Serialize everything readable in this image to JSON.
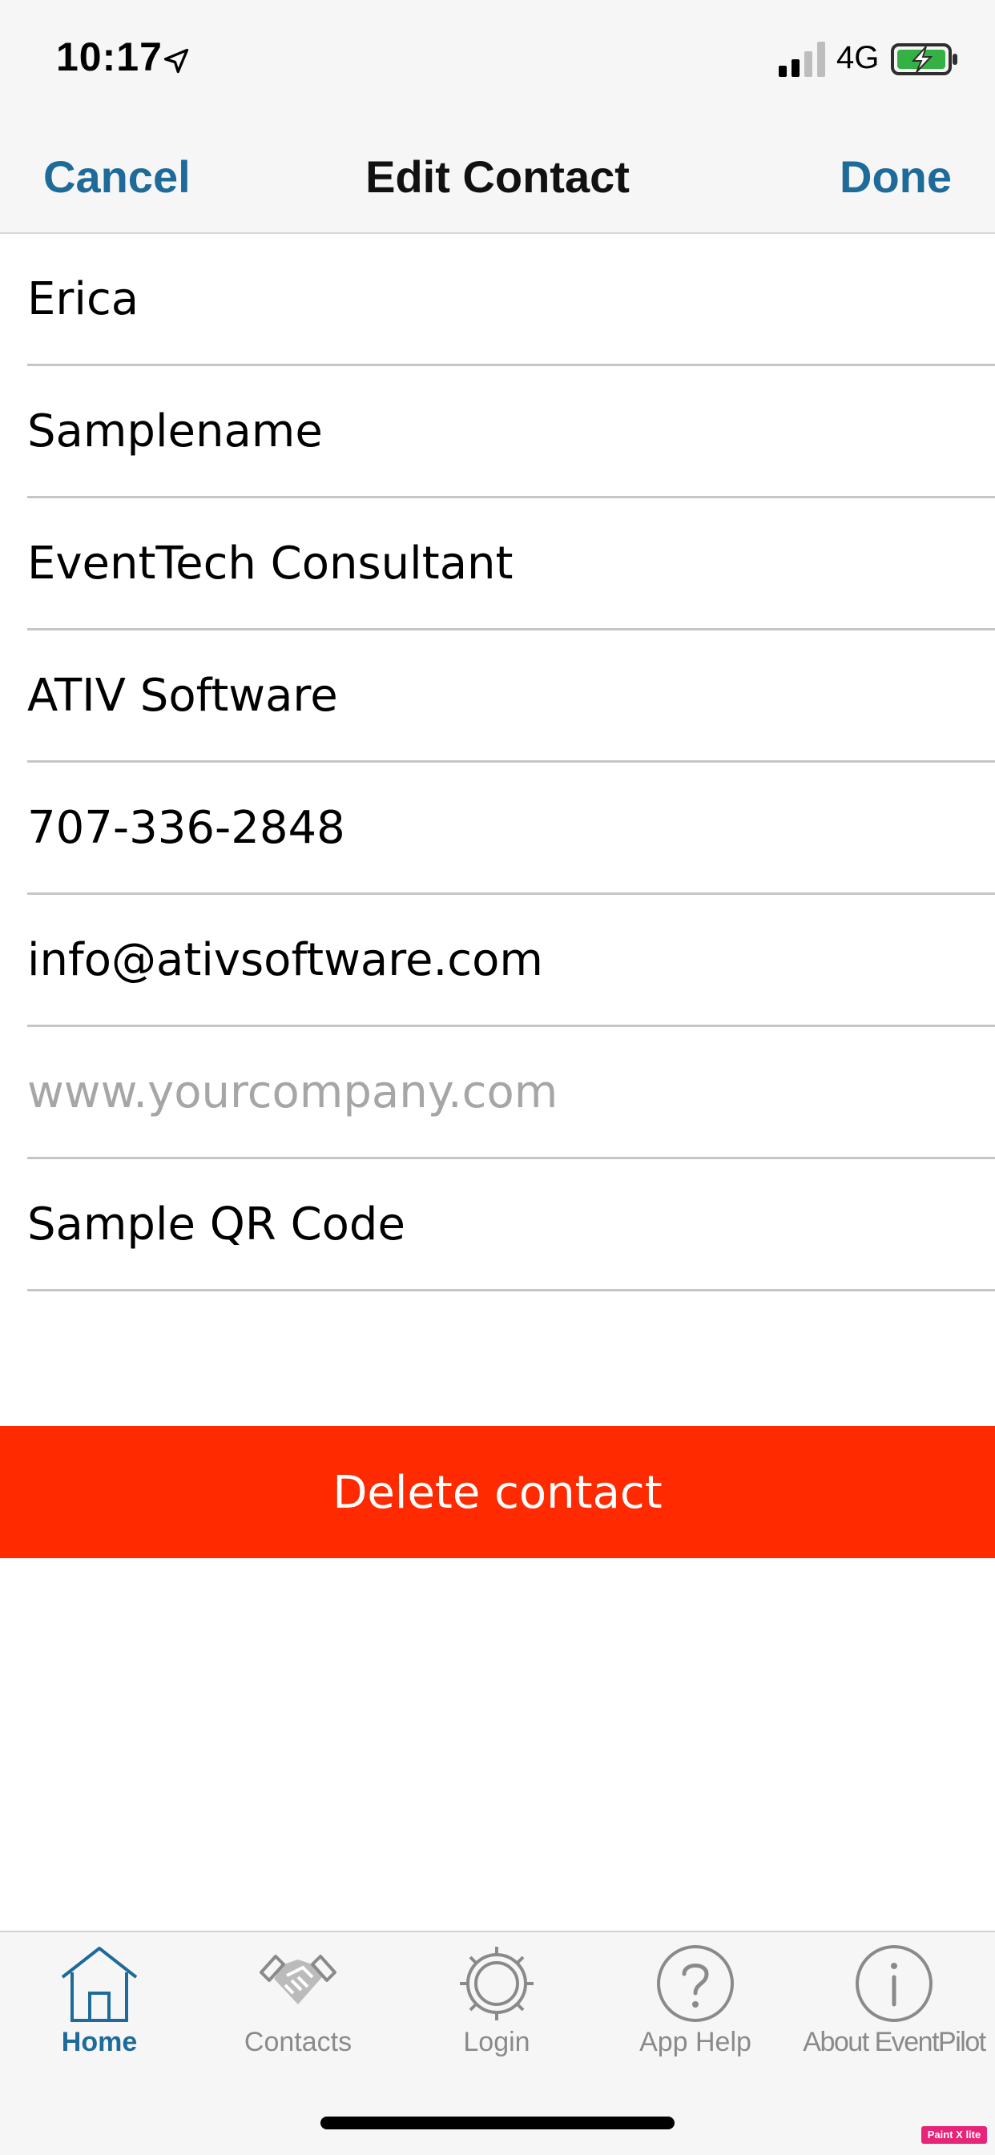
{
  "status_bar": {
    "time": "10:17",
    "network": "4G",
    "icons": [
      "location-arrow-icon",
      "signal-icon",
      "battery-charging-icon"
    ]
  },
  "nav": {
    "cancel_label": "Cancel",
    "title": "Edit Contact",
    "done_label": "Done",
    "accent_color": "#1e6a99"
  },
  "form": {
    "fields": [
      {
        "value": "Erica",
        "placeholder": ""
      },
      {
        "value": "Samplename",
        "placeholder": ""
      },
      {
        "value": "EventTech Consultant",
        "placeholder": ""
      },
      {
        "value": "ATIV Software",
        "placeholder": ""
      },
      {
        "value": "707-336-2848",
        "placeholder": ""
      },
      {
        "value": "info@ativsoftware.com",
        "placeholder": ""
      },
      {
        "value": "",
        "placeholder": "www.yourcompany.com"
      },
      {
        "value": "Sample QR Code",
        "placeholder": ""
      }
    ]
  },
  "delete_button": {
    "label": "Delete contact",
    "color": "#ff2a00"
  },
  "tab_bar": {
    "tabs": [
      {
        "label": "Home",
        "icon": "house-icon",
        "active": true
      },
      {
        "label": "Contacts",
        "icon": "handshake-icon",
        "active": false
      },
      {
        "label": "Login",
        "icon": "gear-icon",
        "active": false
      },
      {
        "label": "App Help",
        "icon": "question-circle-icon",
        "active": false
      },
      {
        "label": "About EventPilot",
        "icon": "info-circle-icon",
        "active": false
      }
    ]
  },
  "watermark": {
    "text": "Paint X lite"
  }
}
